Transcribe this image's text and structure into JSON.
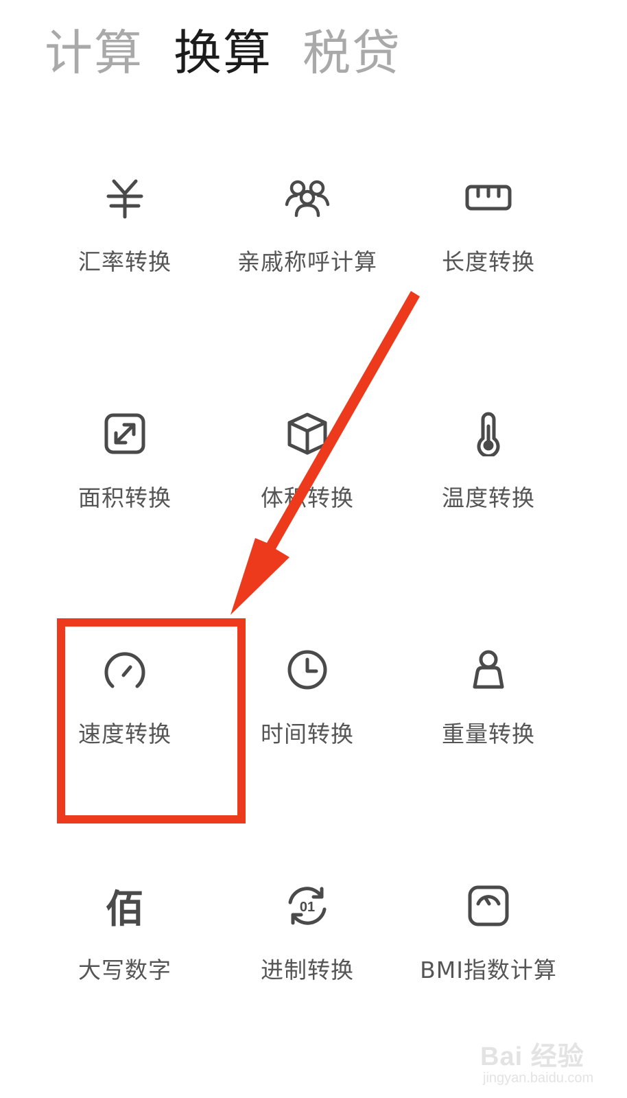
{
  "tabs": [
    {
      "label": "计算",
      "active": false
    },
    {
      "label": "换算",
      "active": true
    },
    {
      "label": "税贷",
      "active": false
    }
  ],
  "tools": [
    {
      "label": "汇率转换",
      "icon": "yuan-currency-icon"
    },
    {
      "label": "亲戚称呼计算",
      "icon": "relatives-people-icon"
    },
    {
      "label": "长度转换",
      "icon": "ruler-icon"
    },
    {
      "label": "面积转换",
      "icon": "expand-square-icon"
    },
    {
      "label": "体积转换",
      "icon": "cube-icon"
    },
    {
      "label": "温度转换",
      "icon": "thermometer-icon"
    },
    {
      "label": "速度转换",
      "icon": "speedometer-icon"
    },
    {
      "label": "时间转换",
      "icon": "clock-icon"
    },
    {
      "label": "重量转换",
      "icon": "weight-icon"
    },
    {
      "label": "大写数字",
      "icon": "bai-character-icon",
      "icon_text": "佰"
    },
    {
      "label": "进制转换",
      "icon": "binary-refresh-icon",
      "icon_text": "01"
    },
    {
      "label": "BMI指数计算",
      "icon": "scale-gauge-icon"
    }
  ],
  "annotation": {
    "color": "#ee3a1c"
  },
  "watermark": {
    "main": "Bai 经验",
    "sub": "jingyan.baidu.com"
  },
  "colors": {
    "icon": "#4a4a4a",
    "label": "#555555",
    "active_tab": "#1c1c1c",
    "inactive_tab": "#a9a9a9"
  }
}
